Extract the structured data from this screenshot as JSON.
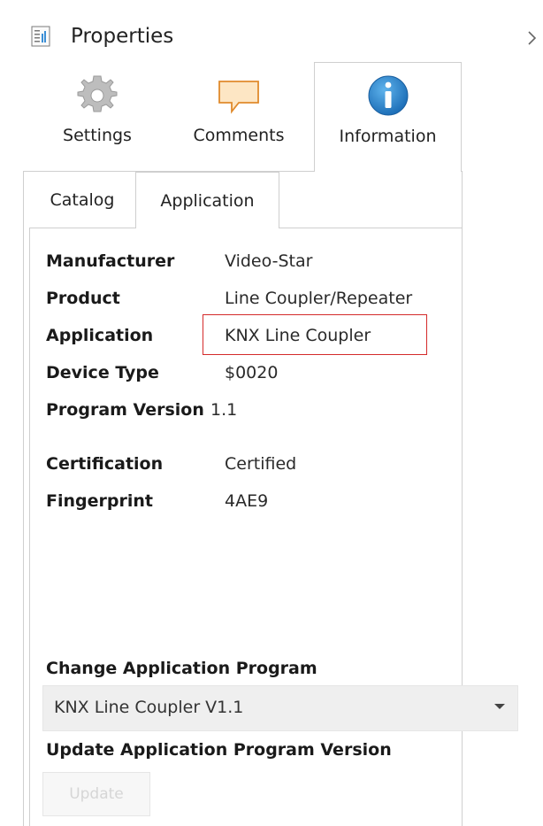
{
  "header": {
    "title": "Properties",
    "icon": "properties-icon"
  },
  "top_tabs": [
    {
      "label": "Settings",
      "icon": "gear-icon",
      "active": false
    },
    {
      "label": "Comments",
      "icon": "comment-icon",
      "active": false
    },
    {
      "label": "Information",
      "icon": "info-icon",
      "active": true
    }
  ],
  "inner_tabs": [
    {
      "label": "Catalog",
      "active": false
    },
    {
      "label": "Application",
      "active": true
    }
  ],
  "properties": [
    {
      "label": "Manufacturer",
      "value": "Video-Star"
    },
    {
      "label": "Product",
      "value": "Line Coupler/Repeater"
    },
    {
      "label": "Application",
      "value": "KNX Line Coupler",
      "highlighted": true
    },
    {
      "label": "Device Type",
      "value": "$0020"
    },
    {
      "label": "Program Version",
      "value": "1.1"
    },
    {
      "label": "Certification",
      "value": "Certified"
    },
    {
      "label": "Fingerprint",
      "value": "4AE9"
    }
  ],
  "change_program": {
    "title": "Change Application Program",
    "selected": "KNX Line Coupler V1.1"
  },
  "update_program": {
    "title": "Update Application Program Version",
    "button_label": "Update",
    "enabled": false
  },
  "colors": {
    "highlight": "#d42a2a",
    "info_blue": "#1d7fc7",
    "border": "#cfcfcf"
  }
}
